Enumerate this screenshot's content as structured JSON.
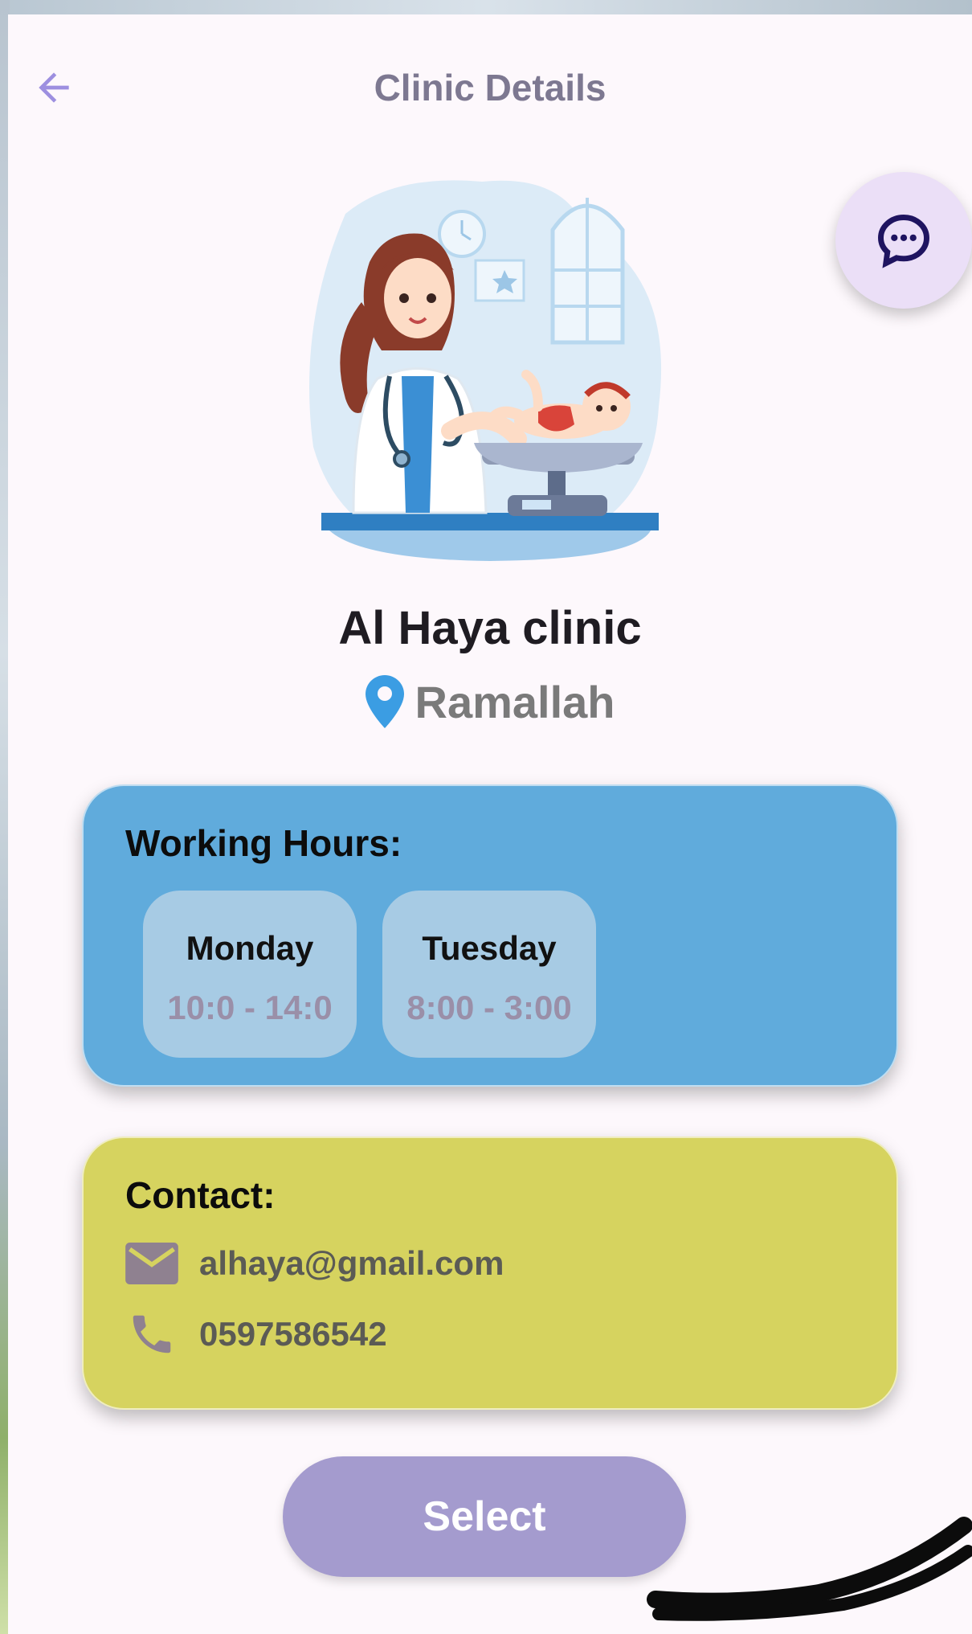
{
  "app_bar": {
    "title": "Clinic Details",
    "back_icon": "arrow-back-icon"
  },
  "chat_fab": {
    "icon": "chat-bubble-icon"
  },
  "clinic": {
    "name": "Al Haya clinic",
    "location_icon": "location-pin-icon",
    "location": "Ramallah"
  },
  "working_hours": {
    "title": "Working Hours:",
    "days": [
      {
        "day": "Monday",
        "time": "10:0 - 14:0"
      },
      {
        "day": "Tuesday",
        "time": "8:00 - 3:00"
      }
    ]
  },
  "contact": {
    "title": "Contact:",
    "email_icon": "email-icon",
    "email": "alhaya@gmail.com",
    "phone_icon": "phone-icon",
    "phone": "0597586542"
  },
  "select_button": {
    "label": "Select"
  },
  "colors": {
    "hours_card": "#60abdc",
    "contact_card": "#d6d35f",
    "accent": "#a49bce",
    "location_pin": "#3b9de3"
  }
}
